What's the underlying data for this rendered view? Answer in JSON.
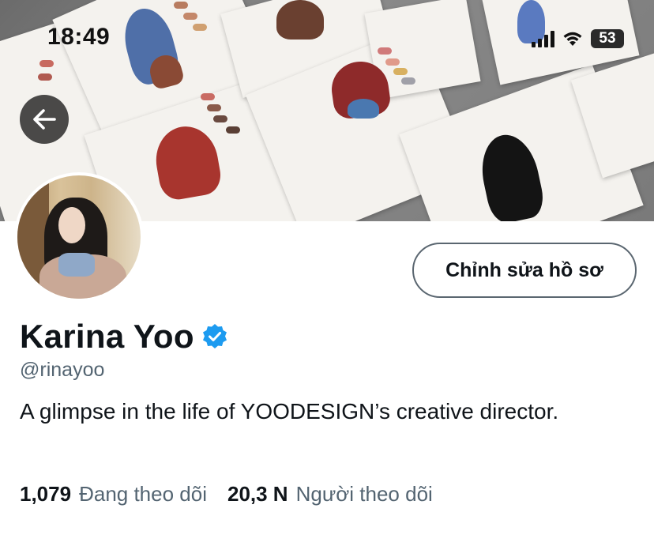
{
  "status_bar": {
    "time": "18:49",
    "battery": "53"
  },
  "profile": {
    "name": "Karina Yoo",
    "handle": "@rinayoo",
    "bio": "A glimpse in the life of YOODESIGN’s creative director.",
    "edit_button_label": "Chỉnh sửa hồ sơ",
    "verified_badge_color": "#1d9bf0"
  },
  "stats": [
    {
      "value": "1,079",
      "label": "Đang theo dõi"
    },
    {
      "value": "20,3 N",
      "label": "Người theo dõi"
    }
  ],
  "icons": {
    "back": "arrow-left-icon",
    "verified": "verified-badge-icon"
  }
}
